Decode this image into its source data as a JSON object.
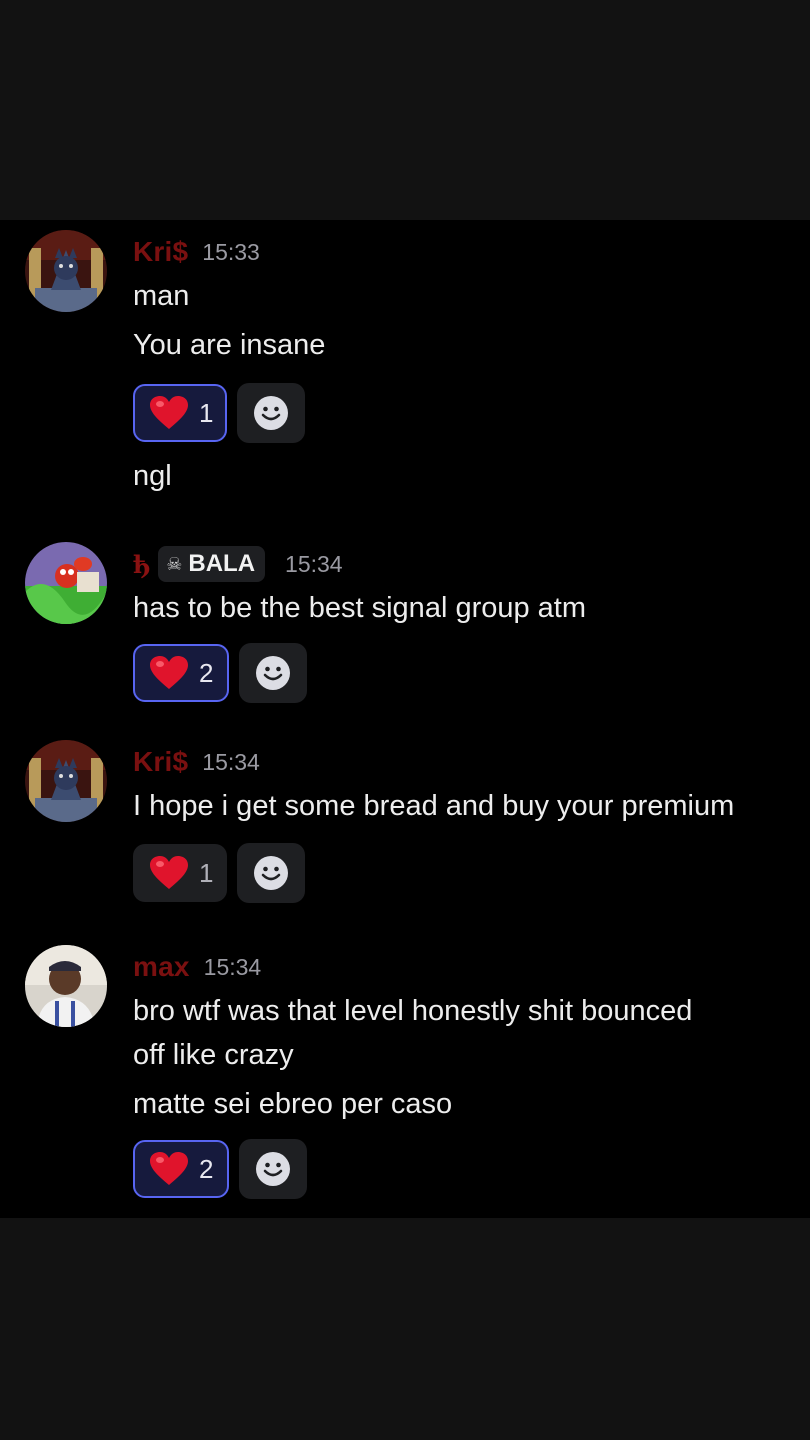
{
  "messages": [
    {
      "username": "Kri$",
      "time": "15:33",
      "avatar": "wolf-avatar",
      "lines": [
        "man",
        "You are insane"
      ],
      "reaction": {
        "emoji": "heart",
        "count": "1",
        "active": true
      },
      "after_lines": [
        "ngl"
      ]
    },
    {
      "username": "ђ",
      "badge": {
        "icon": "skull-crossbones-icon",
        "text": "BALA"
      },
      "time": "15:34",
      "avatar": "crab-avatar",
      "lines": [
        "has to be the best signal group atm"
      ],
      "reaction": {
        "emoji": "heart",
        "count": "2",
        "active": true
      }
    },
    {
      "username": "Kri$",
      "time": "15:34",
      "avatar": "wolf-avatar",
      "lines": [
        "I hope i get some bread and buy your premium"
      ],
      "reaction": {
        "emoji": "heart",
        "count": "1",
        "active": false
      }
    },
    {
      "username": "max",
      "time": "15:34",
      "avatar": "photo-avatar",
      "lines": [
        "bro wtf was that level honestly shit bounced",
        "off like crazy",
        "matte sei ebreo per caso"
      ],
      "reaction": {
        "emoji": "heart",
        "count": "2",
        "active": true
      }
    }
  ],
  "colors": {
    "username": "#7a1010",
    "reaction_active_border": "#5865f2",
    "reaction_active_bg": "#161a3d",
    "chip_bg": "#1e1f22"
  }
}
